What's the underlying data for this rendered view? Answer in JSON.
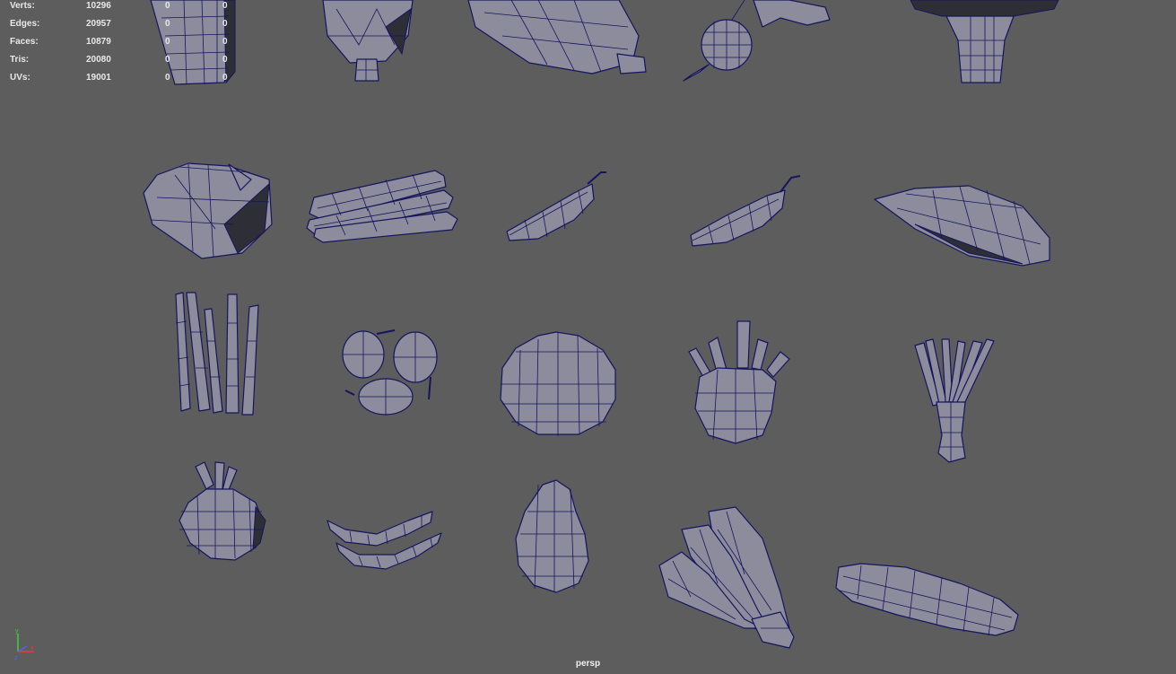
{
  "hud": {
    "rows": [
      {
        "label": "Verts:",
        "values": [
          "10296",
          "0",
          "0"
        ]
      },
      {
        "label": "Edges:",
        "values": [
          "20957",
          "0",
          "0"
        ]
      },
      {
        "label": "Faces:",
        "values": [
          "10879",
          "0",
          "0"
        ]
      },
      {
        "label": "Tris:",
        "values": [
          "20080",
          "0",
          "0"
        ]
      },
      {
        "label": "UVs:",
        "values": [
          "19001",
          "0",
          "0"
        ]
      }
    ]
  },
  "camera": "persp",
  "colors": {
    "background": "#5d5d5d",
    "model_fill": "#8c8c9c",
    "wireframe": "#15155e"
  },
  "icons": [
    "axis-gizmo-icon"
  ]
}
